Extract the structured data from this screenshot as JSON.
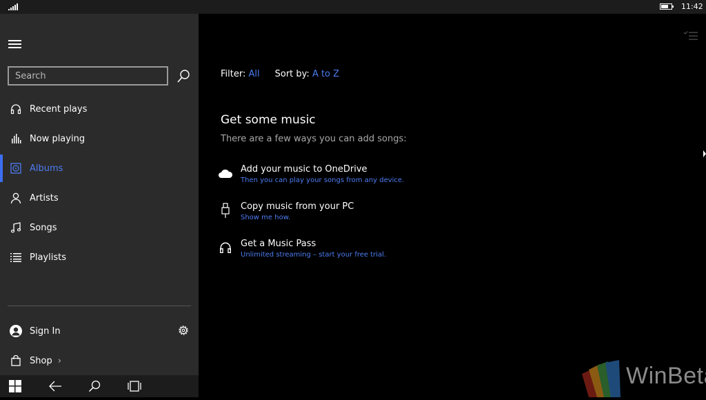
{
  "status_bar": {
    "time": "11:42",
    "battery_level": 0.7,
    "signal_bars": 5,
    "icons": [
      "signal-icon",
      "battery-icon"
    ]
  },
  "sidebar": {
    "menu_icon": "hamburger-icon",
    "search": {
      "placeholder": "Search",
      "value": "",
      "icon": "search-icon"
    },
    "nav_items": [
      {
        "label": "Recent plays",
        "icon": "headphones-icon",
        "active": false
      },
      {
        "label": "Now playing",
        "icon": "equalizer-icon",
        "active": false
      },
      {
        "label": "Albums",
        "icon": "album-icon",
        "active": true
      },
      {
        "label": "Artists",
        "icon": "person-icon",
        "active": false
      },
      {
        "label": "Songs",
        "icon": "music-note-icon",
        "active": false
      },
      {
        "label": "Playlists",
        "icon": "playlist-icon",
        "active": false
      }
    ],
    "sign_in": {
      "label": "Sign In",
      "icon": "avatar-icon"
    },
    "settings_icon": "gear-icon",
    "shop": {
      "label": "Shop",
      "chevron": "›",
      "icon": "shopping-bag-icon"
    }
  },
  "taskbar": {
    "buttons": [
      "windows-start-icon",
      "back-arrow-icon",
      "search-icon",
      "task-view-icon"
    ]
  },
  "main": {
    "filter": {
      "label": "Filter:",
      "value": "All"
    },
    "sort": {
      "label": "Sort by:",
      "value": "A to Z"
    },
    "heading": "Get some music",
    "subheading": "There are a few ways you can add songs:",
    "options": [
      {
        "title": "Add your music to OneDrive",
        "subtitle": "Then you can play your songs from any device.",
        "icon": "cloud-icon"
      },
      {
        "title": "Copy music from your PC",
        "subtitle": "Show me how.",
        "icon": "usb-icon"
      },
      {
        "title": "Get a Music Pass",
        "subtitle": "Unlimited streaming – start your free trial.",
        "icon": "headphones-icon"
      }
    ],
    "select_icon": "multi-select-icon"
  },
  "watermark": {
    "text": "WinBeta"
  },
  "colors": {
    "accent": "#4d7cf2",
    "sidebar_bg": "#2b2b2b",
    "main_bg": "#000000",
    "statusbar_bg": "#1c1c1c"
  }
}
